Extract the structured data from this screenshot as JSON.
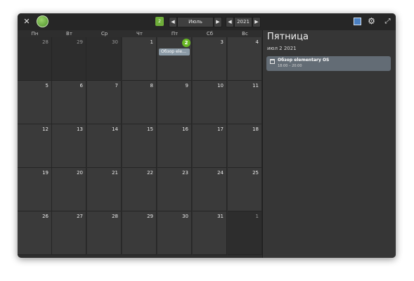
{
  "titlebar": {
    "close_icon": "close-icon",
    "logo_icon": "calendar-app-logo",
    "today_icon": "today-icon",
    "today_badge_text": "2",
    "month_prev": "◀",
    "month_label": "Июль",
    "month_next": "▶",
    "year_prev": "◀",
    "year_label": "2021",
    "year_next": "▶",
    "add_event_icon": "add-event-icon",
    "settings_glyph": "⚙",
    "fullscreen_glyph": "⤢"
  },
  "weekdays": [
    "Пн",
    "Вт",
    "Ср",
    "Чт",
    "Пт",
    "Сб",
    "Вс"
  ],
  "days": [
    "28",
    "29",
    "30",
    "1",
    "2",
    "3",
    "4",
    "5",
    "6",
    "7",
    "8",
    "9",
    "10",
    "11",
    "12",
    "13",
    "14",
    "15",
    "16",
    "17",
    "18",
    "19",
    "20",
    "21",
    "22",
    "23",
    "24",
    "25",
    "26",
    "27",
    "28",
    "29",
    "30",
    "31",
    "1"
  ],
  "month_event_chip": "Обзор ele…",
  "side_panel": {
    "day_name": "Пятница",
    "date_text": "июл  2 2021",
    "event": {
      "title": "Обзор elementary OS",
      "time": "18:00 – 20:00"
    }
  },
  "colors": {
    "accent_green": "#68b723",
    "event_chip": "#8b9aa6",
    "event_card": "#636c75"
  }
}
